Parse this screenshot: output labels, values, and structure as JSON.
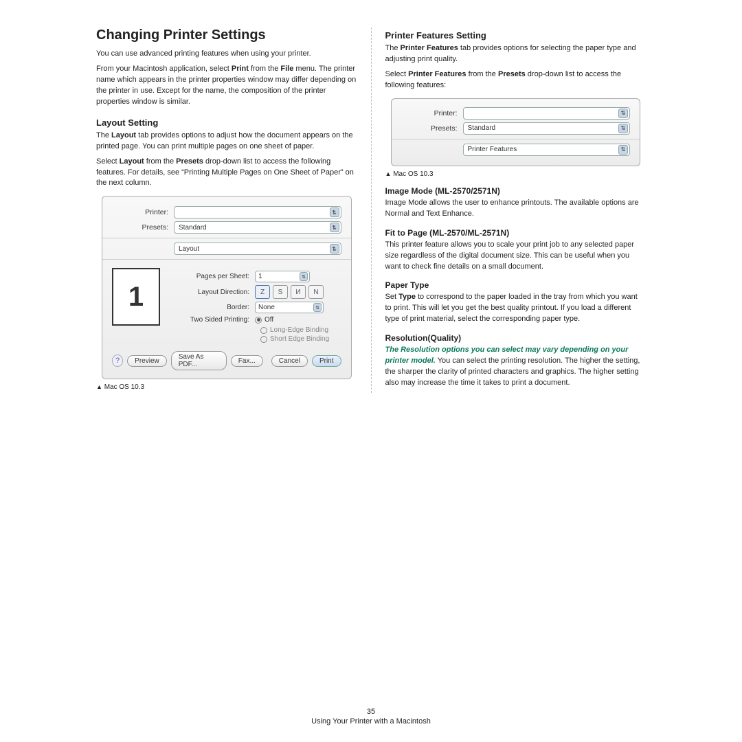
{
  "left": {
    "title": "Changing Printer Settings",
    "intro": "You can use advanced printing features when using your printer.",
    "para_from_pre": "From your Macintosh application, select ",
    "para_from_b1": "Print",
    "para_from_mid": " from the ",
    "para_from_b2": "File",
    "para_from_post": " menu. The printer name which appears in the printer properties window may differ depending on the printer in use. Except for the name, the composition of the printer properties window is similar.",
    "layout_h": "Layout Setting",
    "layout_p1_pre": "The ",
    "layout_p1_b": "Layout",
    "layout_p1_post": " tab provides options to adjust how the document appears on the printed page. You can print multiple pages on one sheet of paper.",
    "layout_p2_pre": "Select ",
    "layout_p2_b1": "Layout",
    "layout_p2_mid": " from the ",
    "layout_p2_b2": "Presets",
    "layout_p2_post": " drop-down list to access the following features. For details, see “Printing Multiple Pages on One Sheet of Paper” on the next column.",
    "caption": "Mac OS 10.3"
  },
  "dlg1": {
    "printer_label": "Printer:",
    "presets_label": "Presets:",
    "presets_value": "Standard",
    "section_value": "Layout",
    "pps_label": "Pages per Sheet:",
    "pps_value": "1",
    "dir_label": "Layout Direction:",
    "border_label": "Border:",
    "border_value": "None",
    "twosided_label": "Two Sided Printing:",
    "off": "Off",
    "long": "Long-Edge Binding",
    "short": "Short Edge Binding",
    "btn_preview": "Preview",
    "btn_save": "Save As PDF...",
    "btn_fax": "Fax...",
    "btn_cancel": "Cancel",
    "btn_print": "Print",
    "help": "?",
    "preview_num": "1",
    "dir_Z": "Z",
    "dir_S": "S",
    "dir_U": "И",
    "dir_N": "N"
  },
  "right": {
    "pf_h": "Printer Features Setting",
    "pf_p1_pre": "The ",
    "pf_p1_b": "Printer Features",
    "pf_p1_post": " tab provides options for selecting the paper type and adjusting print quality.",
    "pf_p2_pre": "Select ",
    "pf_p2_b1": "Printer Features",
    "pf_p2_mid": " from the ",
    "pf_p2_b2": "Presets",
    "pf_p2_post": " drop-down list to access the following features:",
    "caption": "Mac OS 10.3",
    "im_h": "Image Mode (ML-2570/2571N)",
    "im_p": "Image Mode allows the user to enhance printouts. The available options are Normal and Text Enhance.",
    "fit_h": "Fit to Page (ML-2570/ML-2571N)",
    "fit_p": "This printer feature allows you to scale your print job to any selected paper size regardless of the digital document size. This can be useful when you want to check fine details on a small document.",
    "pt_h": "Paper Type",
    "pt_p_pre": "Set ",
    "pt_p_b": "Type",
    "pt_p_post": " to correspond to the paper loaded in the tray from which you want to print. This will let you get the best quality printout. If you load a different type of print material, select the corresponding paper type.",
    "res_h": "Resolution(Quality)",
    "res_note": "The Resolution options you can select may vary depending on your printer model.",
    "res_p": " You can select the printing resolution. The higher the setting, the sharper the clarity of printed characters and graphics. The higher setting also may increase the time it takes to print a document."
  },
  "dlg2": {
    "printer_label": "Printer:",
    "presets_label": "Presets:",
    "presets_value": "Standard",
    "section_value": "Printer Features"
  },
  "footer": {
    "page": "35",
    "chapter": "Using Your Printer with a Macintosh"
  },
  "tri": "▲"
}
